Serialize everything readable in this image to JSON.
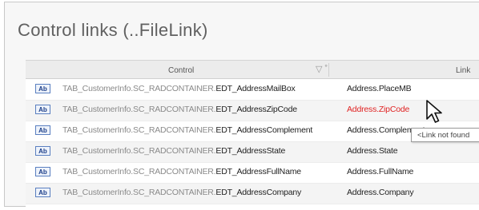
{
  "panel": {
    "title": "Control links (..FileLink)"
  },
  "grid": {
    "columns": {
      "control": "Control",
      "filter": "▽ ˚",
      "link": "Link"
    },
    "rows": [
      {
        "badge": "Ab",
        "prefix": "TAB_CustomerInfo.SC_RADCONTAINER.",
        "name": "EDT_AddressMailBox",
        "link": "Address.PlaceMB",
        "error": false
      },
      {
        "badge": "Ab",
        "prefix": "TAB_CustomerInfo.SC_RADCONTAINER.",
        "name": "EDT_AddressZipCode",
        "link": "Address.ZipCode",
        "error": true
      },
      {
        "badge": "Ab",
        "prefix": "TAB_CustomerInfo.SC_RADCONTAINER.",
        "name": "EDT_AddressComplement",
        "link": "Address.Complement",
        "error": false
      },
      {
        "badge": "Ab",
        "prefix": "TAB_CustomerInfo.SC_RADCONTAINER.",
        "name": "EDT_AddressState",
        "link": "Address.State",
        "error": false
      },
      {
        "badge": "Ab",
        "prefix": "TAB_CustomerInfo.SC_RADCONTAINER.",
        "name": "EDT_AddressFullName",
        "link": "Address.FullName",
        "error": false
      },
      {
        "badge": "Ab",
        "prefix": "TAB_CustomerInfo.SC_RADCONTAINER.",
        "name": "EDT_AddressCompany",
        "link": "Address.Company",
        "error": false
      }
    ]
  },
  "tooltip": {
    "text": "<Link not found"
  },
  "colors": {
    "error": "#e02424",
    "badge_border": "#5a7fc0",
    "badge_text": "#1d3f8a"
  },
  "icons": {
    "badge": "edit-control-icon",
    "pointer": "mouse-pointer-icon",
    "filter": "filter-icon"
  }
}
